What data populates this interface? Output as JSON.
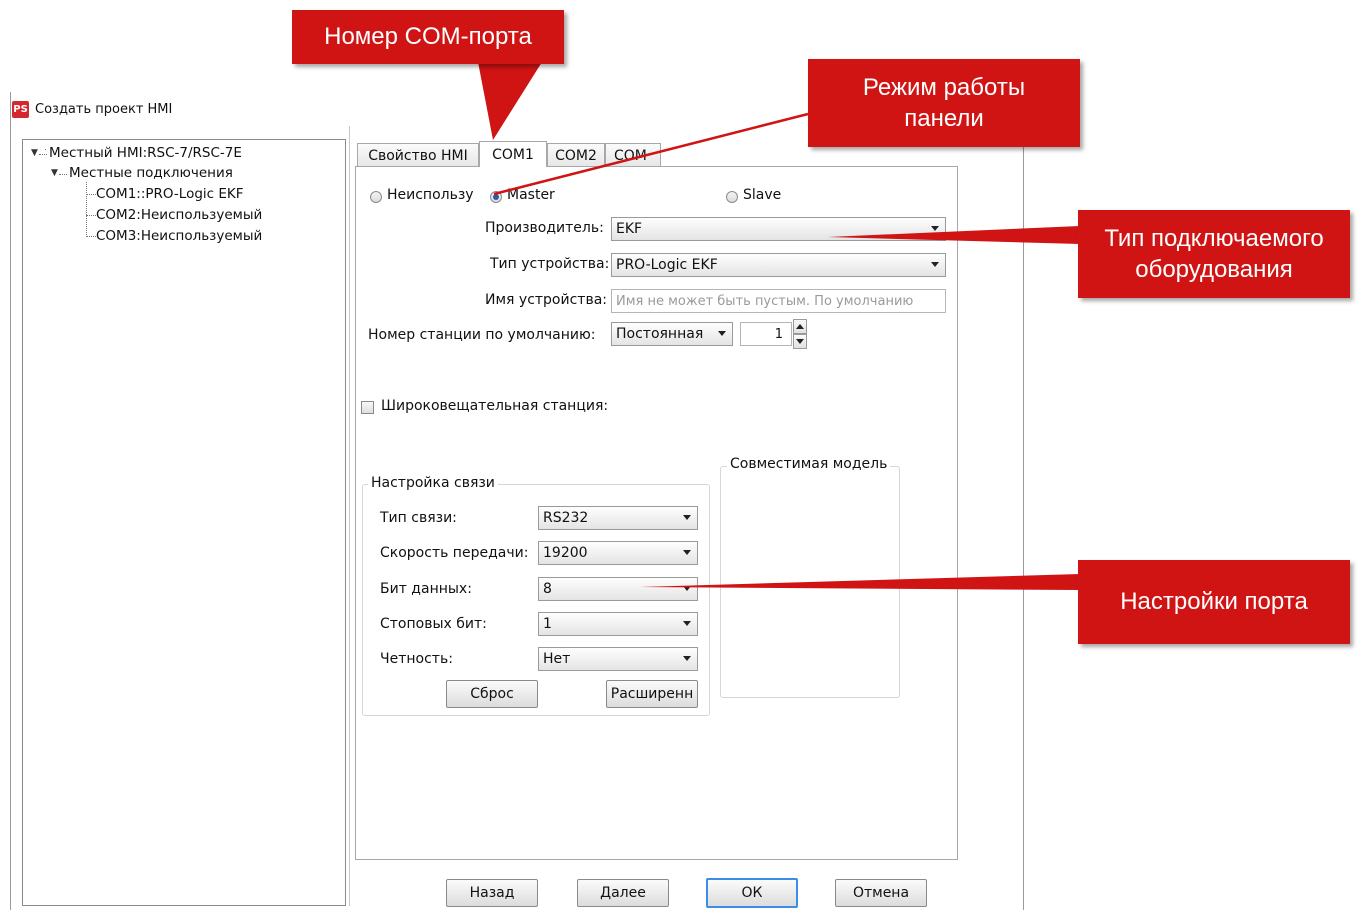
{
  "window": {
    "title": "Создать проект HMI",
    "icon_text": "PS"
  },
  "tree": {
    "root": "Местный HMI:RSC-7/RSC-7E",
    "group": "Местные подключения",
    "items": [
      "COM1::PRO-Logic EKF",
      "COM2:Неиспользуемый",
      "COM3:Неиспользуемый"
    ]
  },
  "tabs": [
    "Свойство HMI",
    "COM1",
    "COM2",
    "COM"
  ],
  "mode": {
    "unused": "Неиспользу",
    "master": "Master",
    "slave": "Slave",
    "selected": "Master"
  },
  "form": {
    "manufacturer_label": "Производитель:",
    "manufacturer_value": "EKF",
    "device_type_label": "Тип устройства:",
    "device_type_value": "PRO-Logic EKF",
    "device_name_label": "Имя устройства:",
    "device_name_placeholder": "Имя не может быть пустым. По умолчанию",
    "station_label": "Номер станции по умолчанию:",
    "station_mode": "Постоянная",
    "station_number": "1",
    "broadcast_label": "Широковещательная станция:",
    "broadcast_checked": false
  },
  "comm": {
    "title": "Настройка связи",
    "type_label": "Тип связи:",
    "type_value": "RS232",
    "baud_label": "Скорость передачи:",
    "baud_value": "19200",
    "databits_label": "Бит данных:",
    "databits_value": "8",
    "stopbits_label": "Стоповых бит:",
    "stopbits_value": "1",
    "parity_label": "Четность:",
    "parity_value": "Нет",
    "reset_button": "Сброс",
    "advanced_button": "Расширенн"
  },
  "compatible_model": {
    "title": "Совместимая модель"
  },
  "footer": {
    "back": "Назад",
    "next": "Далее",
    "ok": "ОК",
    "cancel": "Отмена"
  },
  "callouts": {
    "com_port": "Номер COM-порта",
    "panel_mode": "Режим работы панели",
    "equipment_type": "Тип подключаемого оборудования",
    "port_settings": "Настройки порта"
  },
  "colors": {
    "callout": "#d01414",
    "focus_border": "#3a8ee6",
    "selected_radio": "#2a5ca8"
  }
}
